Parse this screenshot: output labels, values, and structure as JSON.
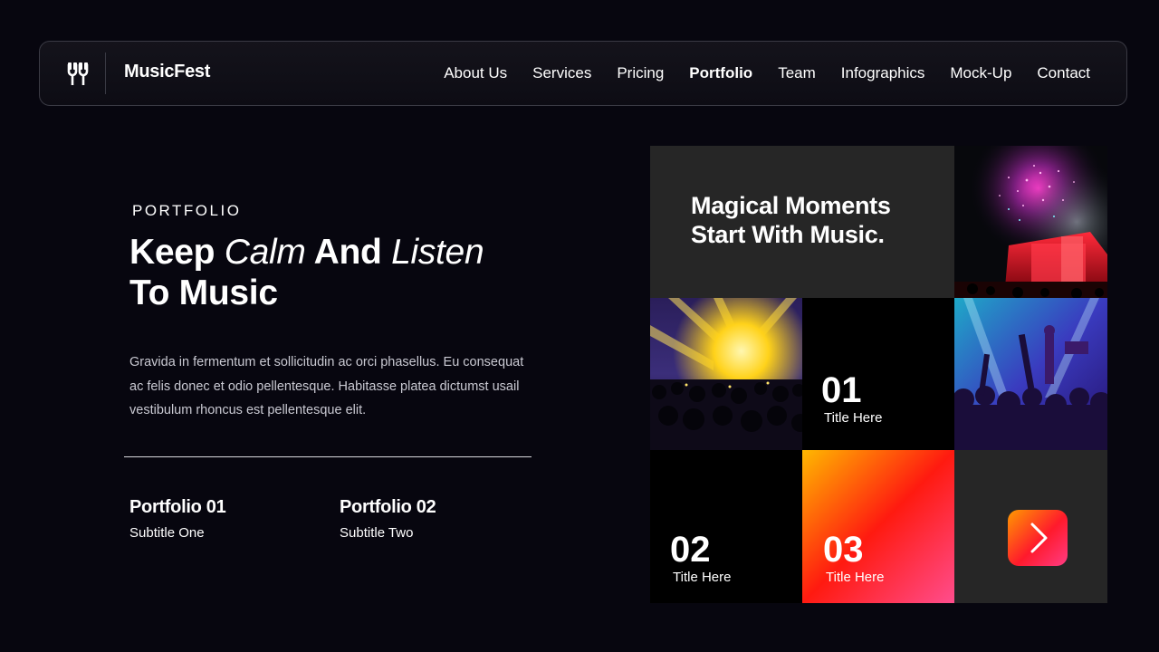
{
  "nav": {
    "brand": "MusicFest",
    "logo_icon": "plug-icon",
    "items": [
      {
        "label": "About Us",
        "active": false
      },
      {
        "label": "Services",
        "active": false
      },
      {
        "label": "Pricing",
        "active": false
      },
      {
        "label": "Portfolio",
        "active": true
      },
      {
        "label": "Team",
        "active": false
      },
      {
        "label": "Infographics",
        "active": false
      },
      {
        "label": "Mock-Up",
        "active": false
      },
      {
        "label": "Contact",
        "active": false
      }
    ]
  },
  "hero": {
    "eyebrow": "PORTFOLIO",
    "headline": {
      "part1": "Keep ",
      "part2": "Calm",
      "part3": " And ",
      "part4": "Listen",
      "part5": "To Music"
    },
    "body": "Gravida in fermentum et sollicitudin ac orci phasellus. Eu consequat ac felis donec et odio pellentesque. Habitasse platea dictumst usail vestibulum rhoncus est pellentesque elit."
  },
  "portfolio": [
    {
      "title": "Portfolio 01",
      "subtitle": "Subtitle One"
    },
    {
      "title": "Portfolio 02",
      "subtitle": "Subtitle Two"
    }
  ],
  "grid": {
    "tagline_line1": "Magical Moments",
    "tagline_line2": "Start With Music.",
    "tiles": [
      {
        "number": "01",
        "label": "Title Here"
      },
      {
        "number": "02",
        "label": "Title Here"
      },
      {
        "number": "03",
        "label": "Title Here"
      }
    ],
    "next_icon": "chevron-right-icon"
  },
  "colors": {
    "background": "#07060f",
    "tile_dark": "#262626",
    "accent_orange": "#ff9a00",
    "accent_red": "#ff1a2c",
    "accent_pink": "#ff3c84"
  }
}
